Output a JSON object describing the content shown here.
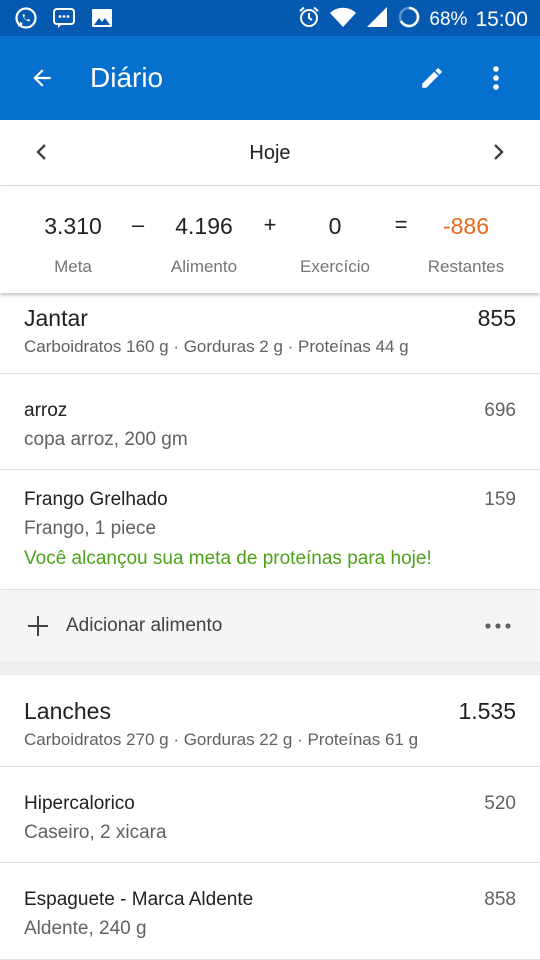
{
  "status_bar": {
    "battery": "68%",
    "time": "15:00"
  },
  "app_bar": {
    "title": "Diário"
  },
  "date_nav": {
    "label": "Hoje"
  },
  "summary": {
    "goal_value": "3.310",
    "goal_label": "Meta",
    "op_minus": "–",
    "food_value": "4.196",
    "food_label": "Alimento",
    "op_plus": "+",
    "exercise_value": "0",
    "exercise_label": "Exercício",
    "op_equals": "=",
    "remaining_value": "-886",
    "remaining_label": "Restantes",
    "remaining_color": "#e66a1e"
  },
  "meals": [
    {
      "name": "Jantar",
      "calories": "855",
      "macros": "Carboidratos 160 g · Gorduras 2 g · Proteínas 44 g",
      "entries": [
        {
          "name": "arroz",
          "desc": "copa arroz, 200 gm",
          "calories": "696"
        },
        {
          "name": "Frango Grelhado",
          "desc": "Frango, 1 piece",
          "calories": "159",
          "note": "Você alcançou sua meta de proteínas para hoje!"
        }
      ],
      "add_label": "Adicionar alimento"
    },
    {
      "name": "Lanches",
      "calories": "1.535",
      "macros": "Carboidratos 270 g · Gorduras 22 g · Proteínas 61 g",
      "entries": [
        {
          "name": "Hipercalorico",
          "desc": "Caseiro, 2 xicara",
          "calories": "520"
        },
        {
          "name": "Espaguete - Marca Aldente",
          "desc": "Aldente, 240 g",
          "calories": "858"
        }
      ]
    }
  ],
  "colors": {
    "status_bar": "#0559b0",
    "app_bar": "#0670cf",
    "success_note": "#4ca21a"
  },
  "icons": [
    "whatsapp-icon",
    "message-icon",
    "image-icon",
    "alarm-icon",
    "wifi-icon",
    "signal-icon",
    "battery-icon",
    "back-arrow-icon",
    "edit-pencil-icon",
    "more-vert-icon",
    "chevron-left-icon",
    "chevron-right-icon",
    "plus-icon",
    "more-horiz-icon"
  ]
}
